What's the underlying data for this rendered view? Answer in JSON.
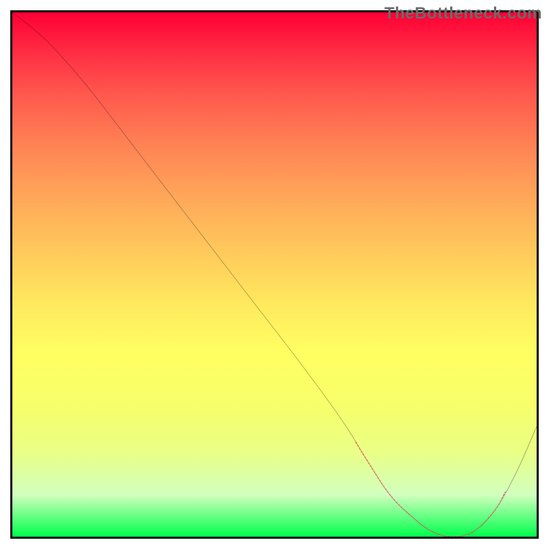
{
  "watermark": "TheBottleneck.com",
  "colors": {
    "curve": "#000000",
    "highlight": "#e06666",
    "border": "#000000"
  },
  "chart_data": {
    "type": "line",
    "title": "",
    "xlabel": "",
    "ylabel": "",
    "xlim": [
      0,
      100
    ],
    "ylim": [
      0,
      100
    ],
    "series": [
      {
        "name": "bottleneck-curve",
        "x": [
          0,
          5,
          9,
          15,
          25,
          35,
          45,
          55,
          63,
          68,
          72,
          76,
          80,
          84,
          88,
          92,
          96,
          100
        ],
        "y": [
          100,
          96,
          92,
          85,
          72,
          59,
          46,
          33,
          22,
          14,
          8,
          4,
          1,
          0,
          1,
          5,
          12,
          21
        ]
      }
    ],
    "highlight_range_x": [
      68,
      92
    ],
    "note": "Axis values are percentage coordinates inside the plot rectangle. y is plotted with origin at the bottom (inverted for SVG)."
  }
}
